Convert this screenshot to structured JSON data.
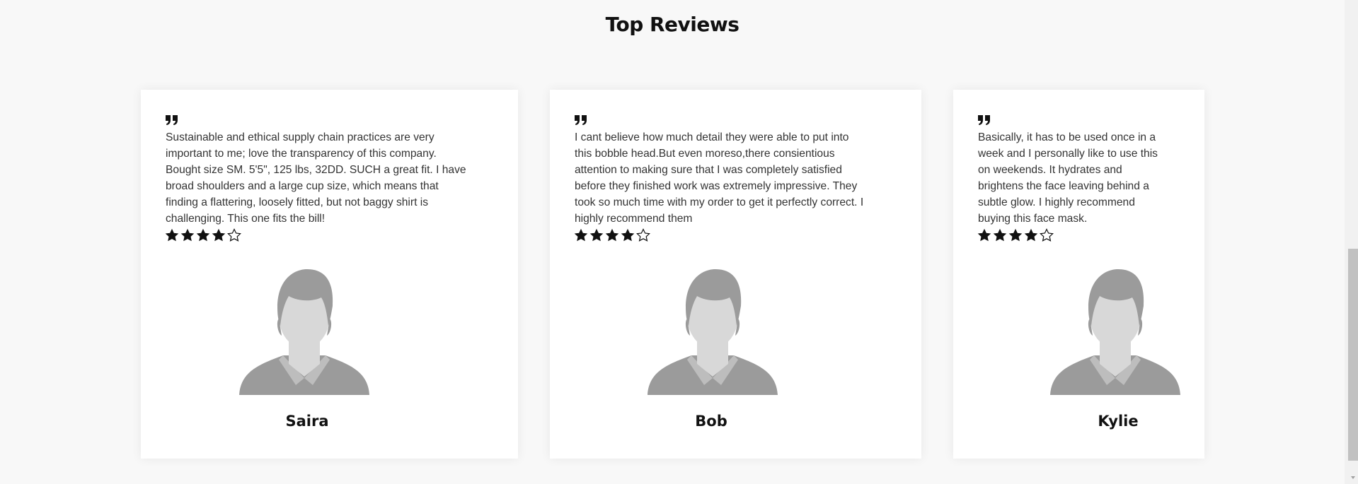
{
  "section": {
    "title": "Top Reviews"
  },
  "reviews": [
    {
      "lines": [
        "Sustainable and ethical supply chain practices are very",
        "important to me; love the transparency of this company.",
        "Bought size SM. 5'5\", 125 lbs, 32DD. SUCH a great fit. I have",
        "broad shoulders and a large cup size, which means that",
        "finding a flattering, loosely fitted, but not baggy shirt is",
        "challenging. This one fits the bill!"
      ],
      "rating": 4,
      "max_rating": 5,
      "name": "Saira"
    },
    {
      "lines": [
        "I cant believe how much detail they were able to put into",
        "this bobble head.But even moreso,there consientious",
        "attention to making sure that I was completely satisfied",
        "before they finished work was extremely impressive. They",
        "took so much time with my order to get it perfectly correct. I",
        "highly recommend them"
      ],
      "rating": 4,
      "max_rating": 5,
      "name": "Bob"
    },
    {
      "lines": [
        "Basically, it has to be used once in a",
        "week and I personally like to use this",
        "on weekends. It hydrates and",
        "brightens the face leaving behind a",
        "subtle glow. I highly recommend",
        "buying this face mask."
      ],
      "rating": 4,
      "max_rating": 5,
      "name": "Kylie"
    }
  ],
  "icons": {
    "quote": "quote-icon",
    "star_filled": "star-filled-icon",
    "star_empty": "star-outline-icon",
    "avatar": "avatar-placeholder-icon"
  },
  "colors": {
    "text": "#111111",
    "body_text": "#333333",
    "avatar_dark": "#9b9b9b",
    "avatar_light": "#d8d8d8",
    "card": "#ffffff",
    "background": "#f8f8f8"
  }
}
